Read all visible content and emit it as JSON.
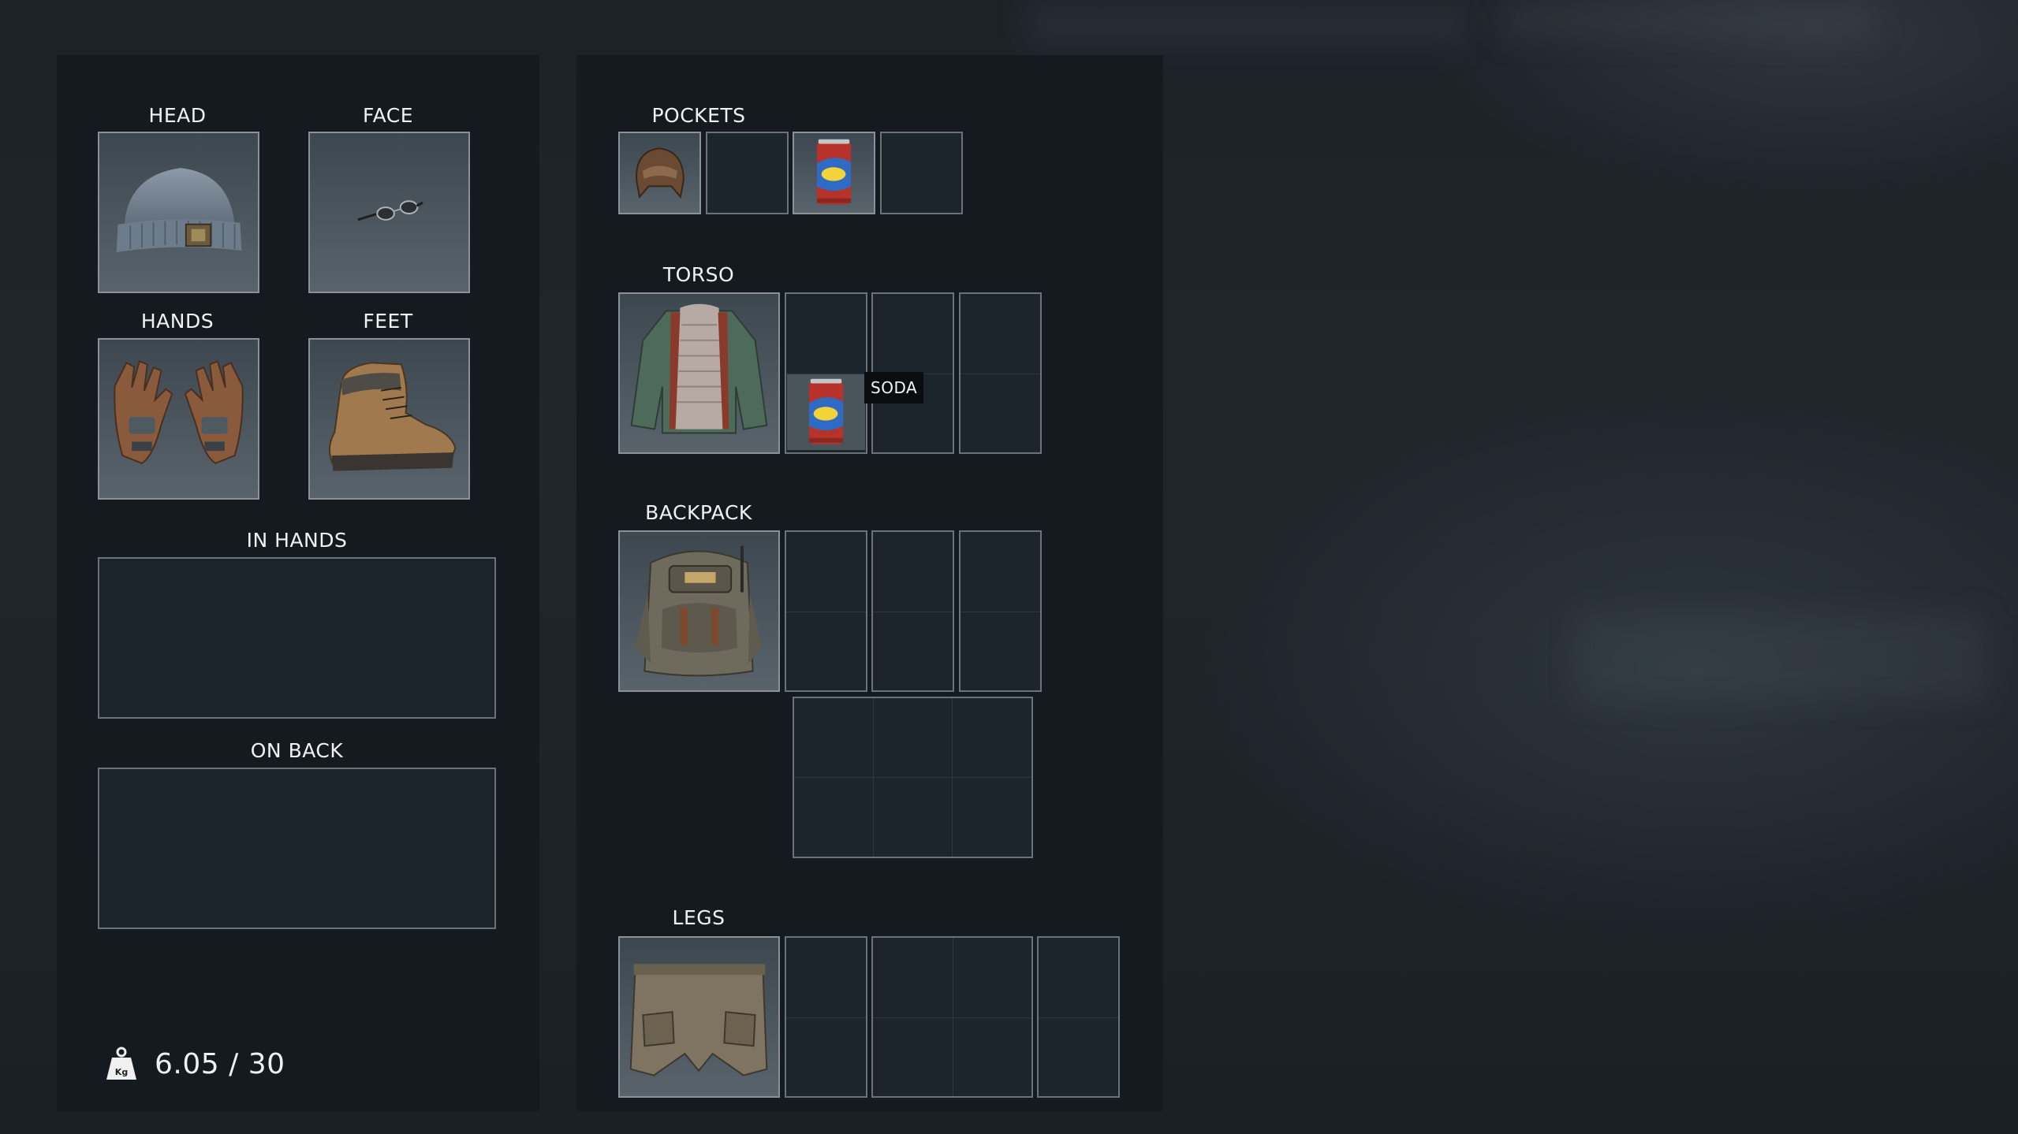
{
  "equipment": {
    "head_label": "HEAD",
    "face_label": "FACE",
    "hands_label": "HANDS",
    "feet_label": "FEET",
    "in_hands_label": "IN HANDS",
    "on_back_label": "ON BACK",
    "head_item": "beanie-icon",
    "face_item": "sunglasses-icon",
    "hands_item": "gloves-icon",
    "feet_item": "boots-icon"
  },
  "cargo": {
    "pockets_label": "POCKETS",
    "torso_label": "TORSO",
    "backpack_label": "BACKPACK",
    "legs_label": "LEGS",
    "pocket_items": [
      "ushanka-hat-icon",
      "empty",
      "soda-can-icon",
      "empty"
    ],
    "torso_item": "jacket-icon",
    "torso_contents": [
      "soda-can-icon"
    ],
    "backpack_item": "backpack-icon",
    "legs_item": "cargo-pants-icon"
  },
  "tooltip": {
    "text": "SODA"
  },
  "weight": {
    "current": "6.05",
    "separator": "/",
    "max": "30",
    "unit_icon_text": "Kg"
  }
}
